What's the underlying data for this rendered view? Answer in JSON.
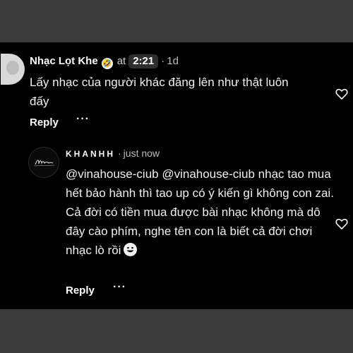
{
  "comment1": {
    "username": "Nhạc Lọt Khe",
    "emoji": "🤣",
    "at_label": "at",
    "timestamp": "2:21",
    "separator": "·",
    "age": "1d",
    "text": "Lấy nhạc của người khác đăng lên như thật luôn đấy",
    "reply_label": "Reply",
    "more_label": "···"
  },
  "comment2": {
    "username": "KHANHH",
    "separator": "·",
    "age": "just now",
    "text": "@vinahouse-ciub @vinahouse-ciub nhạc tao mua hết bảo hành thì tao up có ý kiến gì không con zai. Cả đời có tiền mua được bài nhạc không mà dô đây cào phím, nghe tên con là biết cả đời chơi nhạc lò rồi",
    "reply_label": "Reply",
    "more_label": "···"
  },
  "icons": {
    "like": "heart-icon",
    "smile": "grinning-face-icon"
  }
}
